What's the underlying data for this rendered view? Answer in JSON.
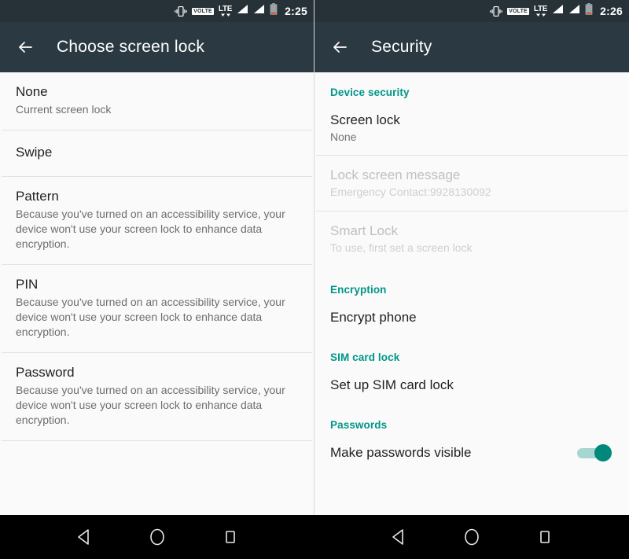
{
  "left_panel": {
    "status_bar": {
      "time": "2:25",
      "icons": [
        "vibrate-icon",
        "volte-icon",
        "lte-icon",
        "signal-bars-icon",
        "signal-bars-icon",
        "battery-icon"
      ],
      "volte_label": "VOLTE",
      "lte_label": "LTE"
    },
    "app_bar": {
      "title": "Choose screen lock",
      "back_icon": "back-arrow-icon"
    },
    "items": [
      {
        "title": "None",
        "subtitle": "Current screen lock"
      },
      {
        "title": "Swipe",
        "subtitle": ""
      },
      {
        "title": "Pattern",
        "subtitle": "Because you've turned on an accessibility service, your device won't use your screen lock to enhance data encryption."
      },
      {
        "title": "PIN",
        "subtitle": "Because you've turned on an accessibility service, your device won't use your screen lock to enhance data encryption."
      },
      {
        "title": "Password",
        "subtitle": "Because you've turned on an accessibility service, your device won't use your screen lock to enhance data encryption."
      }
    ]
  },
  "right_panel": {
    "status_bar": {
      "time": "2:26",
      "icons": [
        "vibrate-icon",
        "volte-icon",
        "lte-icon",
        "signal-bars-icon",
        "signal-bars-icon",
        "battery-icon"
      ],
      "volte_label": "VOLTE",
      "lte_label": "LTE"
    },
    "app_bar": {
      "title": "Security",
      "back_icon": "back-arrow-icon"
    },
    "sections": [
      {
        "header": "Device security",
        "rows": [
          {
            "title": "Screen lock",
            "subtitle": "None",
            "disabled": false
          },
          {
            "title": "Lock screen message",
            "subtitle": "Emergency Contact:9928130092",
            "disabled": true
          },
          {
            "title": "Smart Lock",
            "subtitle": "To use, first set a screen lock",
            "disabled": true
          }
        ]
      },
      {
        "header": "Encryption",
        "rows": [
          {
            "title": "Encrypt phone",
            "subtitle": "",
            "disabled": false
          }
        ]
      },
      {
        "header": "SIM card lock",
        "rows": [
          {
            "title": "Set up SIM card lock",
            "subtitle": "",
            "disabled": false
          }
        ]
      },
      {
        "header": "Passwords",
        "rows": [
          {
            "title": "Make passwords visible",
            "subtitle": "",
            "disabled": false,
            "toggle": "on"
          }
        ]
      }
    ]
  },
  "nav_bar": {
    "buttons": [
      "back-triangle-icon",
      "home-circle-icon",
      "recents-square-icon"
    ]
  },
  "colors": {
    "app_bar": "#2b3a42",
    "status_bar": "#263238",
    "accent_teal": "#009688",
    "toggle_on": "#00897b",
    "background": "#fafafa",
    "battery_low": "#e2562a"
  }
}
